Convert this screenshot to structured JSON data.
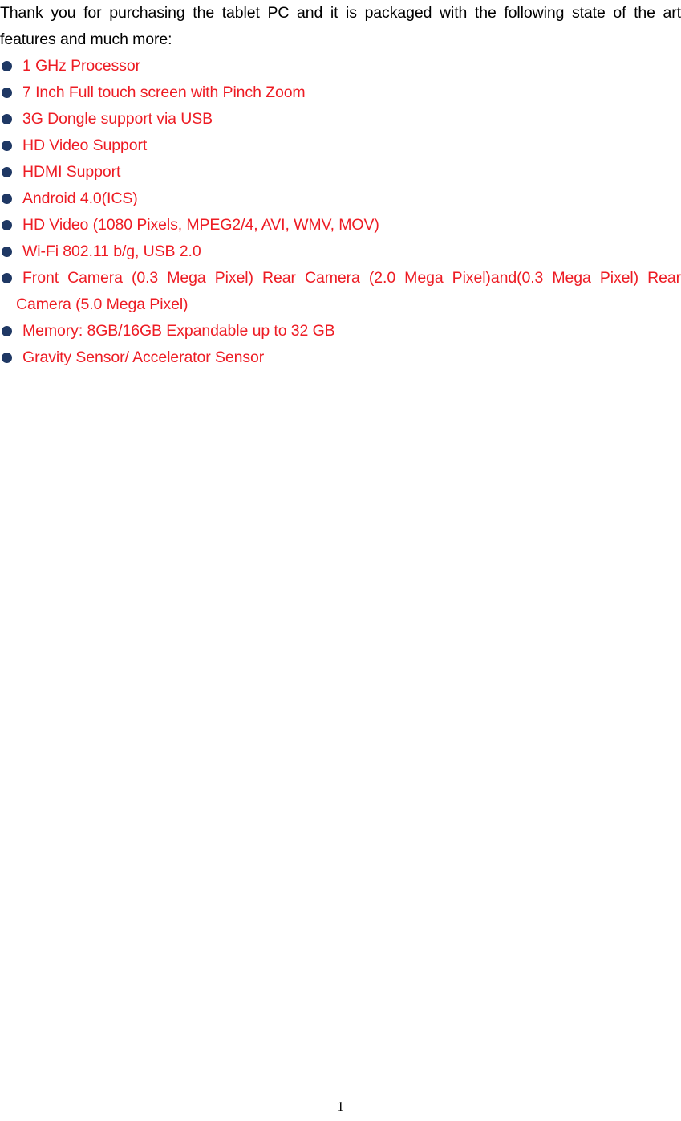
{
  "document": {
    "intro": {
      "line1": "Thank you for purchasing the tablet PC and it is packaged with the following state of the art",
      "line2": "features and much more:",
      "full_text": "Thank you for purchasing the tablet PC and it is packaged with the following state of the art features and much more:"
    },
    "features": [
      {
        "text": "1 GHz Processor",
        "bullet": "filled-circle-bullet-icon"
      },
      {
        "text": "7 Inch Full touch screen with Pinch Zoom",
        "bullet": "filled-circle-bullet-icon"
      },
      {
        "text": "3G Dongle support via USB",
        "bullet": "filled-circle-bullet-icon"
      },
      {
        "text": "HD Video Support",
        "bullet": "filled-circle-bullet-icon"
      },
      {
        "text": "HDMI Support",
        "bullet": "filled-circle-bullet-icon"
      },
      {
        "text": "Android 4.0(ICS)",
        "bullet": "filled-circle-bullet-icon"
      },
      {
        "text": "HD Video (1080 Pixels, MPEG2/4, AVI, WMV, MOV)",
        "bullet": "filled-circle-bullet-icon"
      },
      {
        "text": "Wi-Fi 802.11 b/g, USB 2.0",
        "bullet": "filled-circle-bullet-icon"
      },
      {
        "text": "Front Camera (0.3 Mega Pixel) Rear Camera (2.0 Mega Pixel)and(0.3 Mega Pixel) Rear Camera (5.0 Mega Pixel)",
        "bullet": "filled-circle-bullet-icon"
      },
      {
        "text": "Memory: 8GB/16GB Expandable up to 32 GB",
        "bullet": "filled-circle-bullet-icon"
      },
      {
        "text": "Gravity Sensor/ Accelerator Sensor",
        "bullet": "filled-circle-bullet-icon"
      }
    ],
    "footer": {
      "page_number": "1"
    },
    "colors": {
      "body_text": "#000000",
      "feature_text": "#ED1C24",
      "bullet": "#1F3864",
      "background": "#FFFFFF"
    }
  }
}
